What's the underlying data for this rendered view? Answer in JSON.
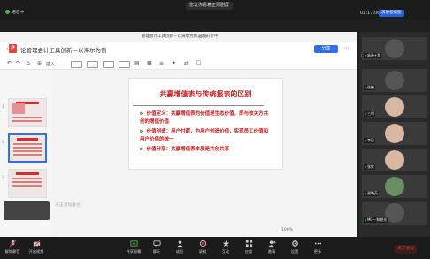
{
  "topbar": {
    "notice": "您让你看着正则剧屏",
    "time": "01:17:06",
    "pill": "演讲者视图",
    "left_tag": "语音中"
  },
  "doc": {
    "window_title": "管理会计工具创新—以海尔为例.pptx",
    "window_state": "已经分享中",
    "file_name": "论管理会计工具创新—以海尔为例",
    "share_label": "分享",
    "insert_label": "插入",
    "note_placeholder": "点击添加备注",
    "zoom": "100%",
    "thumb_numbers": [
      "1",
      "2",
      "3"
    ]
  },
  "slide": {
    "title": "共赢增值表与传统报表的区别",
    "bullets": [
      "价值定义：共赢增值表的价值是生态价值，即与攸关方共创的增值价值",
      "价值创造：用户付薪，为用户创造价值，实现员工价值和用户价值的统一",
      "价值分享：共赢增值表本质是共创共享"
    ]
  },
  "panel": {
    "speaker": "正在讲话: 咏诗(...)",
    "tiles": [
      "咏诗+我",
      "张巍",
      "三明",
      "李阳",
      "张欣",
      "谢晓英",
      "MC一和湘光"
    ]
  },
  "bottom": {
    "buttons": [
      "解除静音",
      "开启视频",
      "共享屏幕",
      "聊天",
      "成员",
      "录制",
      "互动",
      "应用",
      "邀请",
      "设置",
      "更多"
    ],
    "leave_label": "离开会议"
  },
  "colors": {
    "accent": "#2f6fe8",
    "slide_red": "#c81a1a",
    "leave_red": "#e03a3a"
  },
  "icons": [
    "mic-off-icon",
    "video-off-icon",
    "share-screen-icon",
    "chat-icon",
    "members-icon",
    "record-icon",
    "interact-icon",
    "apps-icon",
    "invite-icon",
    "settings-icon",
    "more-icon"
  ]
}
